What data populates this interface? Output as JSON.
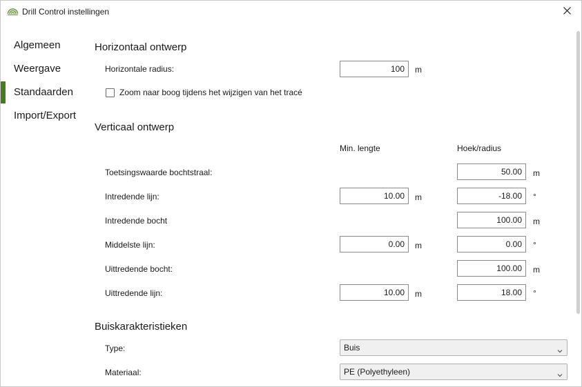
{
  "window": {
    "title": "Drill Control instellingen"
  },
  "sidebar": {
    "items": [
      {
        "label": "Algemeen",
        "active": false
      },
      {
        "label": "Weergave",
        "active": false
      },
      {
        "label": "Standaarden",
        "active": true
      },
      {
        "label": "Import/Export",
        "active": false
      }
    ]
  },
  "horizontal": {
    "title": "Horizontaal ontwerp",
    "radius_label": "Horizontale radius:",
    "radius_value": "100",
    "radius_unit": "m",
    "zoom_label": "Zoom naar boog tijdens het wijzigen van het tracé",
    "zoom_checked": false
  },
  "vertical": {
    "title": "Verticaal ontwerp",
    "col_min_length": "Min. lengte",
    "col_angle_radius": "Hoek/radius",
    "rows": [
      {
        "label": "Toetsingswaarde bochtstraal:",
        "min": null,
        "min_unit": null,
        "hoek": "50.00",
        "hoek_unit": "m"
      },
      {
        "label": "Intredende lijn:",
        "min": "10.00",
        "min_unit": "m",
        "hoek": "-18.00",
        "hoek_unit": "°"
      },
      {
        "label": "Intredende bocht",
        "min": null,
        "min_unit": null,
        "hoek": "100.00",
        "hoek_unit": "m"
      },
      {
        "label": "Middelste lijn:",
        "min": "0.00",
        "min_unit": "m",
        "hoek": "0.00",
        "hoek_unit": "°"
      },
      {
        "label": "Uittredende bocht:",
        "min": null,
        "min_unit": null,
        "hoek": "100.00",
        "hoek_unit": "m"
      },
      {
        "label": "Uittredende lijn:",
        "min": "10.00",
        "min_unit": "m",
        "hoek": "18.00",
        "hoek_unit": "°"
      }
    ]
  },
  "pipe": {
    "title": "Buiskarakteristieken",
    "type_label": "Type:",
    "type_value": "Buis",
    "material_label": "Materiaal:",
    "material_value": "PE (Polyethyleen)"
  },
  "colors": {
    "accent": "#4a7a1e"
  }
}
